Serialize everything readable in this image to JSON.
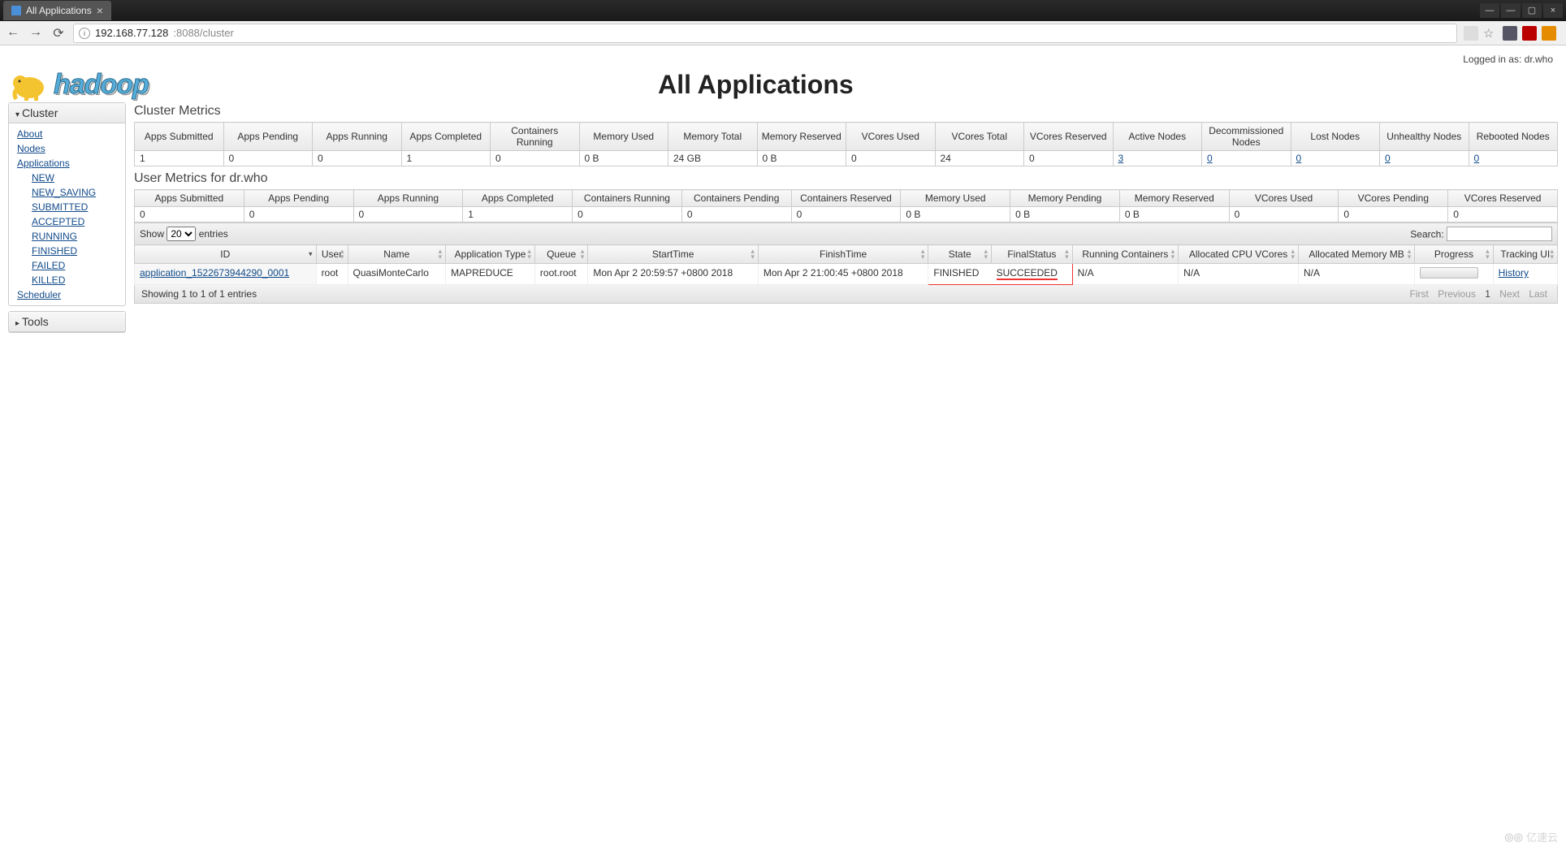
{
  "browser": {
    "tab_title": "All Applications",
    "url_host": "192.168.77.128",
    "url_port_path": ":8088/cluster"
  },
  "header": {
    "logged_in": "Logged in as: dr.who",
    "logo_text": "hadoop",
    "page_title": "All Applications"
  },
  "sidebar": {
    "cluster_label": "Cluster",
    "tools_label": "Tools",
    "about": "About",
    "nodes": "Nodes",
    "applications": "Applications",
    "new_": "NEW",
    "new_saving": "NEW_SAVING",
    "submitted": "SUBMITTED",
    "accepted": "ACCEPTED",
    "running": "RUNNING",
    "finished": "FINISHED",
    "failed": "FAILED",
    "killed": "KILLED",
    "scheduler": "Scheduler"
  },
  "cluster_metrics": {
    "title": "Cluster Metrics",
    "headers": [
      "Apps Submitted",
      "Apps Pending",
      "Apps Running",
      "Apps Completed",
      "Containers Running",
      "Memory Used",
      "Memory Total",
      "Memory Reserved",
      "VCores Used",
      "VCores Total",
      "VCores Reserved",
      "Active Nodes",
      "Decommissioned Nodes",
      "Lost Nodes",
      "Unhealthy Nodes",
      "Rebooted Nodes"
    ],
    "values": [
      "1",
      "0",
      "0",
      "1",
      "0",
      "0 B",
      "24 GB",
      "0 B",
      "0",
      "24",
      "0",
      "3",
      "0",
      "0",
      "0",
      "0"
    ]
  },
  "user_metrics": {
    "title": "User Metrics for dr.who",
    "headers": [
      "Apps Submitted",
      "Apps Pending",
      "Apps Running",
      "Apps Completed",
      "Containers Running",
      "Containers Pending",
      "Containers Reserved",
      "Memory Used",
      "Memory Pending",
      "Memory Reserved",
      "VCores Used",
      "VCores Pending",
      "VCores Reserved"
    ],
    "values": [
      "0",
      "0",
      "0",
      "1",
      "0",
      "0",
      "0",
      "0 B",
      "0 B",
      "0 B",
      "0",
      "0",
      "0"
    ]
  },
  "controls": {
    "show_label": "Show",
    "entries_label": "entries",
    "select_value": "20",
    "search_label": "Search:"
  },
  "apps_table": {
    "headers": [
      "ID",
      "User",
      "Name",
      "Application Type",
      "Queue",
      "StartTime",
      "FinishTime",
      "State",
      "FinalStatus",
      "Running Containers",
      "Allocated CPU VCores",
      "Allocated Memory MB",
      "Progress",
      "Tracking UI"
    ],
    "row": {
      "id": "application_1522673944290_0001",
      "user": "root",
      "name": "QuasiMonteCarlo",
      "type": "MAPREDUCE",
      "queue": "root.root",
      "start": "Mon Apr 2 20:59:57 +0800 2018",
      "finish": "Mon Apr 2 21:00:45 +0800 2018",
      "state": "FINISHED",
      "final_status": "SUCCEEDED",
      "running_containers": "N/A",
      "cpu": "N/A",
      "mem": "N/A",
      "tracking": "History"
    }
  },
  "footer": {
    "info": "Showing 1 to 1 of 1 entries",
    "first": "First",
    "prev": "Previous",
    "one": "1",
    "next": "Next",
    "last": "Last"
  },
  "watermark": "亿速云"
}
